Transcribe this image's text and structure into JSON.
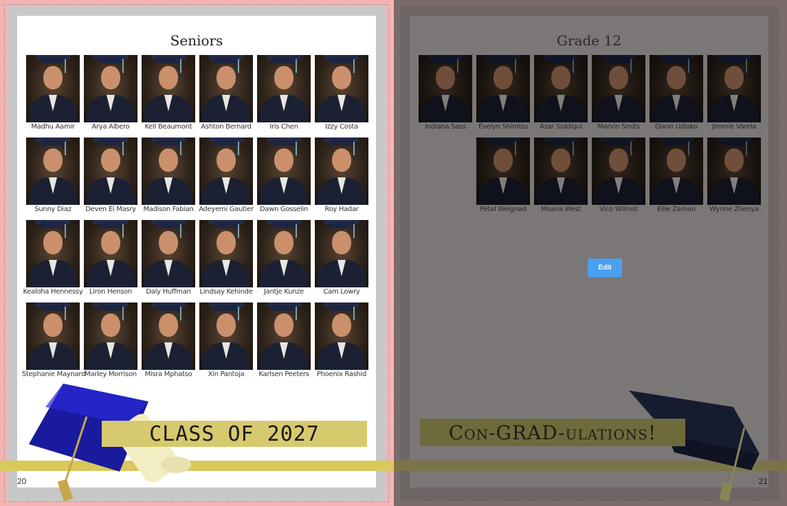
{
  "left_page": {
    "title": "Seniors",
    "page_number": "20",
    "banner_text": "CLASS OF 2027",
    "students": [
      "Madhu Aamir",
      "Arya Albero",
      "Kell Beaumont",
      "Ashton Bernard",
      "Iris Chen",
      "Izzy Costa",
      "Sunny Diaz",
      "Deven El Masry",
      "Madison Fabian",
      "Adeyemi Gautier",
      "Dawn Gosselin",
      "Roy Hadar",
      "Kealoha Hennessy",
      "Liron Henson",
      "Daly Huffman",
      "Lindsay Kehinde",
      "Jantje Kunze",
      "Cam Lowry",
      "Stephanie Maynard",
      "Marley Morrison",
      "Misra Mphatso",
      "Xin Pantoja",
      "Karlsen Peeters",
      "Phoenix Rashid"
    ]
  },
  "right_page": {
    "title": "Grade 12",
    "page_number": "21",
    "banner_text": "Con-GRAD-ulations!",
    "edit_label": "Edit",
    "students": [
      "Indiana Sass",
      "Evelyn Shimizu",
      "Azar Siddiqui",
      "Marvin Smits",
      "Dixon Udiako",
      "Jimmie Varela",
      "",
      "Petal Weignad",
      "Moana West",
      "Vico Wilmot",
      "Ellie Zaman",
      "Wynne Zhenya"
    ]
  },
  "colors": {
    "left_frame": "#f5b4b4",
    "right_frame": "#7a6a6a",
    "banner_gold": "#d6c96e",
    "band_gold": "#d9c85a",
    "edit_button": "#4aa0f0"
  }
}
